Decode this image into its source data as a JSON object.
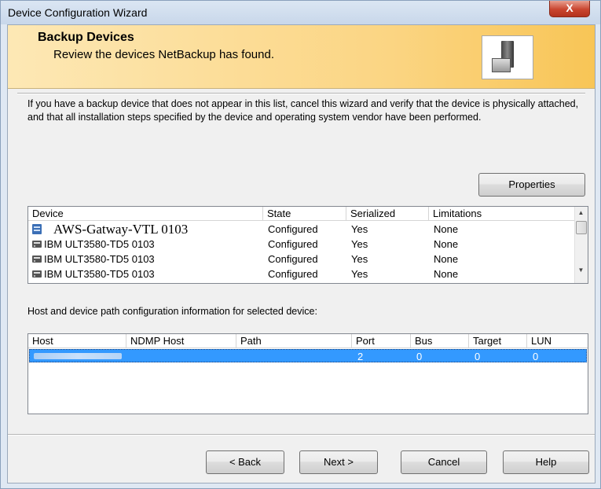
{
  "window": {
    "title": "Device Configuration Wizard",
    "close_label": "X"
  },
  "header": {
    "title": "Backup Devices",
    "subtitle": "Review the devices NetBackup has found."
  },
  "intro_text": "If you have a backup device that does not appear in this list, cancel this wizard and verify that the device is physically attached, and that all installation steps specified by the device and operating system vendor have been performed.",
  "properties_button": "Properties",
  "devices": {
    "columns": [
      "Device",
      "State",
      "Serialized",
      "Limitations"
    ],
    "rows": [
      {
        "icon": "vtl-device-icon",
        "device": "AWS-Gatway-VTL  0103",
        "state": "Configured",
        "serialized": "Yes",
        "limitations": "None"
      },
      {
        "icon": "tape-drive-icon",
        "device": "IBM    ULT3580-TD5    0103",
        "state": "Configured",
        "serialized": "Yes",
        "limitations": "None"
      },
      {
        "icon": "tape-drive-icon",
        "device": "IBM    ULT3580-TD5    0103",
        "state": "Configured",
        "serialized": "Yes",
        "limitations": "None"
      },
      {
        "icon": "tape-drive-icon",
        "device": "IBM    ULT3580-TD5    0103",
        "state": "Configured",
        "serialized": "Yes",
        "limitations": "None"
      }
    ]
  },
  "host_section_label": "Host and device path configuration information for selected device:",
  "hosts": {
    "columns": [
      "Host",
      "NDMP Host",
      "Path",
      "Port",
      "Bus",
      "Target",
      "LUN"
    ],
    "rows": [
      {
        "host": "",
        "ndmp_host": "",
        "path": "",
        "port": "2",
        "bus": "0",
        "target": "0",
        "lun": "0"
      }
    ]
  },
  "buttons": {
    "back": "< Back",
    "next": "Next >",
    "cancel": "Cancel",
    "help": "Help"
  },
  "colors": {
    "selection": "#3399ff",
    "banner": "#fbd583",
    "close": "#c9452f"
  }
}
